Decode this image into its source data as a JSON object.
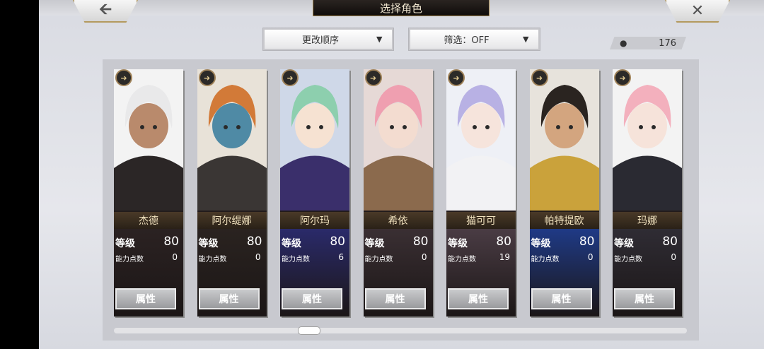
{
  "header": {
    "title": "选择角色",
    "back_icon": "back-arrow-icon",
    "close_icon": "close-icon"
  },
  "controls": {
    "sort_label": "更改顺序",
    "filter_label": "筛选：OFF",
    "count": "176",
    "caret": "▼"
  },
  "labels": {
    "level": "等级",
    "ability_points": "能力点数",
    "attribute_button": "属性"
  },
  "cards": [
    {
      "name": "杰德",
      "level": "80",
      "points": "0",
      "hair": "#e9e9ea",
      "skin": "#b98a6c",
      "outfit": "#2b2626",
      "bg": "#f3f3f3",
      "stats_bg": "#2b2222"
    },
    {
      "name": "阿尔缇娜",
      "level": "80",
      "points": "0",
      "hair": "#d27a38",
      "skin": "#4f8aa5",
      "outfit": "#3a3634",
      "bg": "#e8e2d8",
      "stats_bg": "#2a2320"
    },
    {
      "name": "阿尔玛",
      "level": "80",
      "points": "6",
      "hair": "#8dcfae",
      "skin": "#f6e2d2",
      "outfit": "#3a2f6b",
      "bg": "#cfd8e8",
      "stats_bg": "#2a2a6a"
    },
    {
      "name": "希依",
      "level": "80",
      "points": "0",
      "hair": "#ef9fb0",
      "skin": "#f3dcd0",
      "outfit": "#8b6a4d",
      "bg": "#e6d9d6",
      "stats_bg": "#3a2f33"
    },
    {
      "name": "猫可可",
      "level": "80",
      "points": "19",
      "hair": "#b8b1e4",
      "skin": "#f6e4dc",
      "outfit": "#f2f2f4",
      "bg": "#eef0f6",
      "stats_bg": "#4a3c44"
    },
    {
      "name": "帕特提欧",
      "level": "80",
      "points": "0",
      "hair": "#2a2420",
      "skin": "#d3a57f",
      "outfit": "#caa23b",
      "bg": "#e7e3dc",
      "stats_bg": "#1f3a86"
    },
    {
      "name": "玛娜",
      "level": "80",
      "points": "0",
      "hair": "#f3b0bd",
      "skin": "#f6e3da",
      "outfit": "#2a2a32",
      "bg": "#f3f3f3",
      "stats_bg": "#2f2c34"
    }
  ]
}
